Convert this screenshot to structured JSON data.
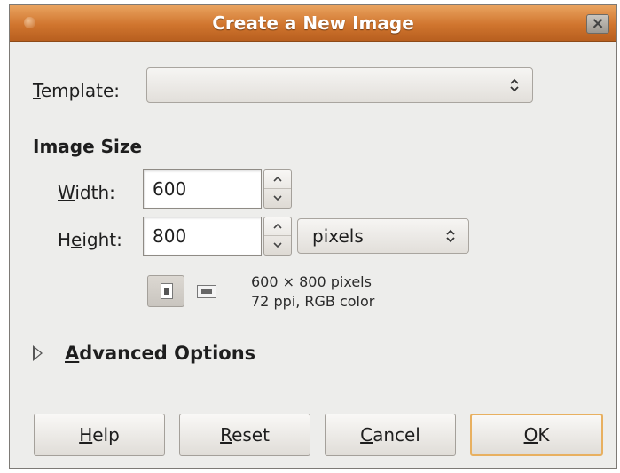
{
  "window": {
    "title": "Create a New Image",
    "close_glyph": "×"
  },
  "template": {
    "label": "Template:",
    "value": ""
  },
  "image_size": {
    "heading": "Image Size",
    "width_label": "Width:",
    "width_value": "600",
    "height_label": "Height:",
    "height_value": "800",
    "unit": "pixels",
    "info_line1": "600 × 800 pixels",
    "info_line2": "72 ppi, RGB color"
  },
  "advanced": {
    "label": "Advanced Options"
  },
  "buttons": {
    "help": "Help",
    "reset": "Reset",
    "cancel": "Cancel",
    "ok": "OK"
  },
  "colors": {
    "titlebar": "#d0752e",
    "dialog_bg": "#ededeb",
    "default_button_border": "#e8b060"
  }
}
